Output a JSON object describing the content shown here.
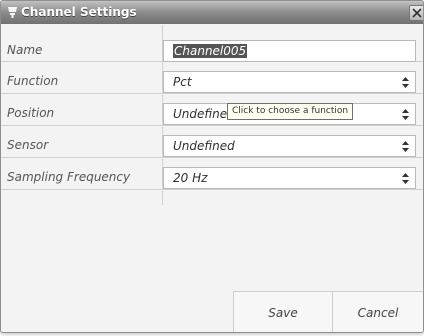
{
  "window": {
    "title": "Channel Settings",
    "close_icon": "close-icon"
  },
  "rows": [
    {
      "label": "Name",
      "value": "Channel005",
      "kind": "text-input",
      "selected": true
    },
    {
      "label": "Function",
      "value": "Pct",
      "kind": "dropdown"
    },
    {
      "label": "Position",
      "value": "Undefine",
      "kind": "dropdown"
    },
    {
      "label": "Sensor",
      "value": "Undefined",
      "kind": "dropdown"
    },
    {
      "label": "Sampling Frequency",
      "value": "20 Hz",
      "kind": "dropdown"
    }
  ],
  "tooltip": {
    "text": "Click to choose a function"
  },
  "buttons": {
    "save": "Save",
    "cancel": "Cancel"
  },
  "colors": {
    "titlebar": "#8b8b8b",
    "selection": "#555555",
    "tooltip_bg": "#fffff2"
  }
}
